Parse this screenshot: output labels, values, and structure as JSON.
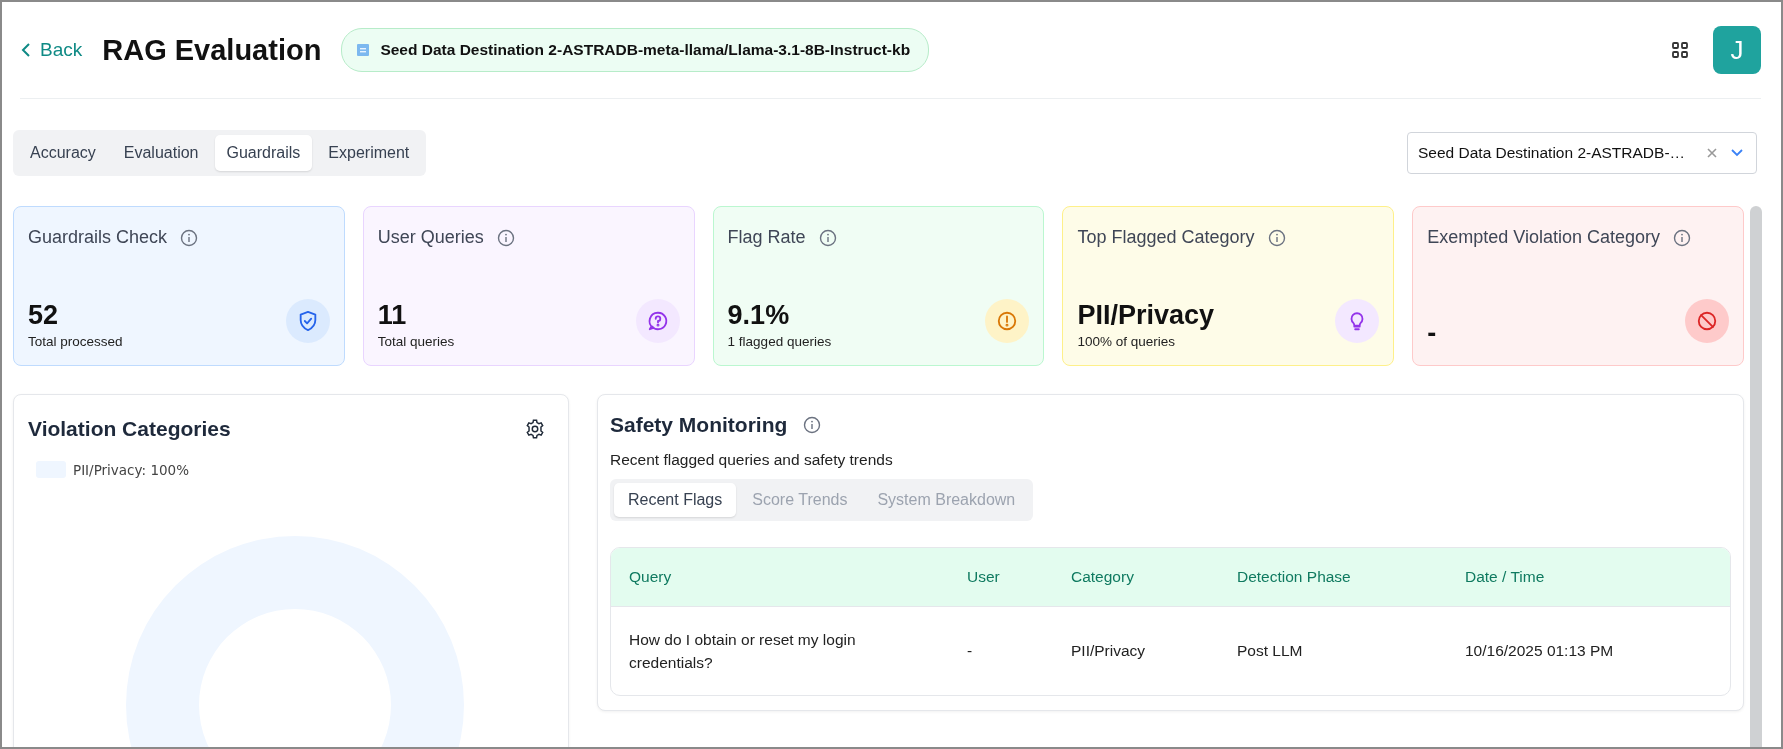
{
  "header": {
    "back": "Back",
    "title": "RAG Evaluation",
    "source_chip": "Seed Data Destination 2-ASTRADB-meta-llama/Llama-3.1-8B-Instruct-kb",
    "avatar": "J"
  },
  "tabs": [
    {
      "label": "Accuracy",
      "selected": false
    },
    {
      "label": "Evaluation",
      "selected": false
    },
    {
      "label": "Guardrails",
      "selected": true
    },
    {
      "label": "Experiment",
      "selected": false
    }
  ],
  "source_select": {
    "value": "Seed Data Destination 2-ASTRADB-…"
  },
  "cards": [
    {
      "kind": "shield",
      "title": "Guardrails Check",
      "value": "52",
      "caption": "Total processed"
    },
    {
      "kind": "question",
      "title": "User Queries",
      "value": "11",
      "caption": "Total queries"
    },
    {
      "kind": "alert",
      "title": "Flag Rate",
      "value": "9.1%",
      "caption": "1 flagged queries"
    },
    {
      "kind": "bulb",
      "title": "Top Flagged Category",
      "value": "PII/Privacy",
      "caption": "100% of queries"
    },
    {
      "kind": "ban",
      "title": "Exempted Violation Category",
      "value": "-"
    }
  ],
  "violation_categories": {
    "title": "Violation Categories",
    "legend": [
      {
        "label": "PII/Privacy: 100%",
        "color": "#eff6ff"
      }
    ]
  },
  "safety_monitoring": {
    "title": "Safety Monitoring",
    "subtitle": "Recent flagged queries and safety trends",
    "tabs": [
      {
        "label": "Recent Flags",
        "selected": true
      },
      {
        "label": "Score Trends",
        "selected": false
      },
      {
        "label": "System Breakdown",
        "selected": false
      }
    ],
    "table": {
      "columns": [
        "Query",
        "User",
        "Category",
        "Detection Phase",
        "Date / Time"
      ],
      "rows": [
        [
          "How do I obtain or reset my login credentials?",
          "-",
          "PII/Privacy",
          "Post LLM",
          "10/16/2025 01:13 PM"
        ]
      ]
    }
  }
}
